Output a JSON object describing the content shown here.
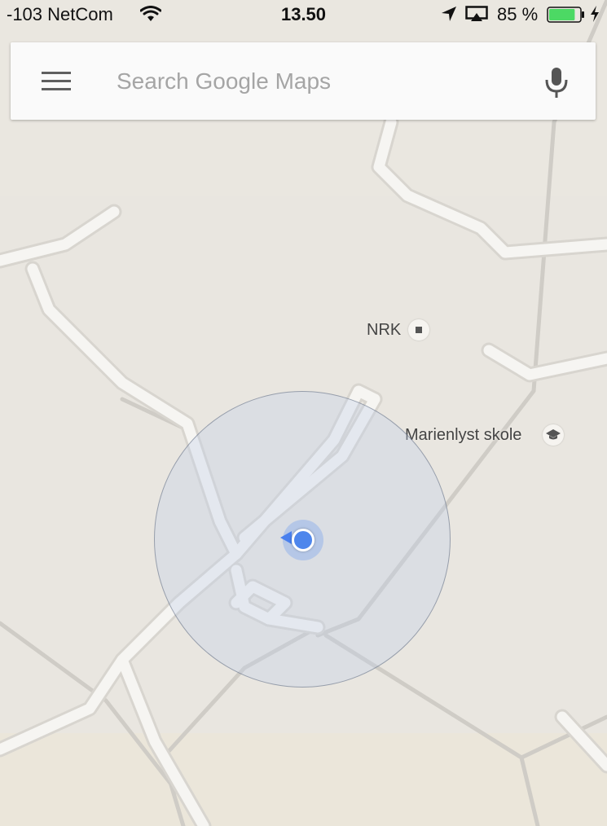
{
  "status_bar": {
    "carrier": "-103 NetCom",
    "time": "13.50",
    "battery_percent": "85 %",
    "battery_level": 0.85,
    "icons": [
      "wifi-icon",
      "location-arrow-icon",
      "airplay-icon",
      "battery-icon",
      "charging-icon"
    ]
  },
  "search": {
    "placeholder": "Search Google Maps",
    "value": "",
    "menu_icon": "menu-icon",
    "mic_icon": "mic-icon"
  },
  "map": {
    "places": [
      {
        "name": "NRK",
        "icon": "square-poi-icon"
      },
      {
        "name": "Marienlyst skole",
        "icon": "school-icon"
      }
    ],
    "my_location": {
      "icon": "my-location-icon",
      "heading": "west"
    }
  },
  "colors": {
    "map_background": "#e9e6e0",
    "road": "#f6f5f2",
    "road_outline": "#cdcbc5",
    "location_blue": "#4e86ec",
    "battery_green": "#4cd964"
  }
}
